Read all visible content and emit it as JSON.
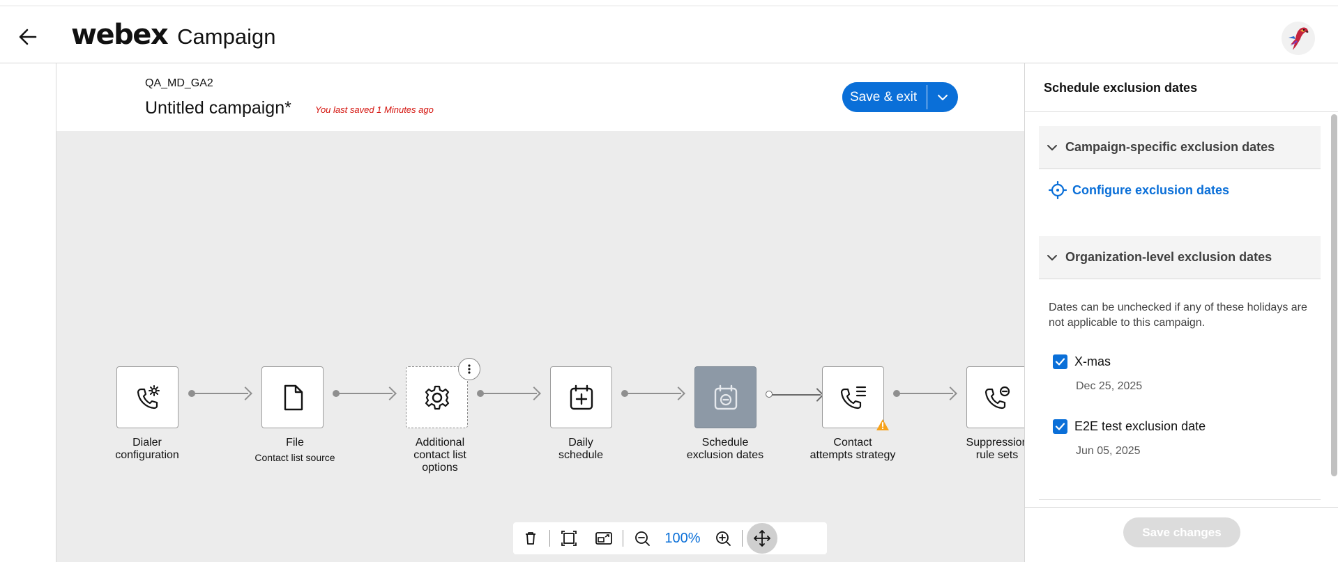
{
  "header": {
    "brand": "webex",
    "app_name": "Campaign"
  },
  "campaign": {
    "code": "QA_MD_GA2",
    "name": "Untitled campaign*",
    "last_saved": "You last saved 1 Minutes ago",
    "save_exit_label": "Save & exit"
  },
  "flow": {
    "nodes": [
      {
        "icon": "phone-gear-icon",
        "label": "Dialer configuration",
        "line1": "Dialer",
        "line2": "configuration"
      },
      {
        "icon": "file-icon",
        "label": "File",
        "sub": "Contact list source"
      },
      {
        "icon": "gear-icon",
        "line1": "Additional",
        "line2": "contact list",
        "line3": "options"
      },
      {
        "icon": "calendar-plus-icon",
        "line1": "Daily",
        "line2": "schedule"
      },
      {
        "icon": "calendar-minus-icon",
        "line1": "Schedule",
        "line2": "exclusion dates"
      },
      {
        "icon": "phone-list-icon",
        "line1": "Contact",
        "line2": "attempts strategy"
      },
      {
        "icon": "phone-block-icon",
        "line1": "Suppression",
        "line2": "rule sets"
      }
    ]
  },
  "toolbar": {
    "zoom_level": "100%"
  },
  "panel": {
    "title": "Schedule exclusion dates",
    "campaign_section": "Campaign-specific exclusion dates",
    "configure_link": "Configure exclusion dates",
    "org_section": "Organization-level exclusion dates",
    "note": "Dates can be unchecked if any of these holidays are not applicable to this campaign.",
    "dates": [
      {
        "name": "X-mas",
        "date": "Dec 25, 2025",
        "checked": true
      },
      {
        "name": "E2E test exclusion date",
        "date": "Jun 05, 2025",
        "checked": true
      }
    ],
    "save_changes_label": "Save changes"
  },
  "colors": {
    "accent": "#0a6fd8",
    "warning": "#f7a21b",
    "error_text": "#d4110b",
    "active_node": "#8d99a6"
  }
}
